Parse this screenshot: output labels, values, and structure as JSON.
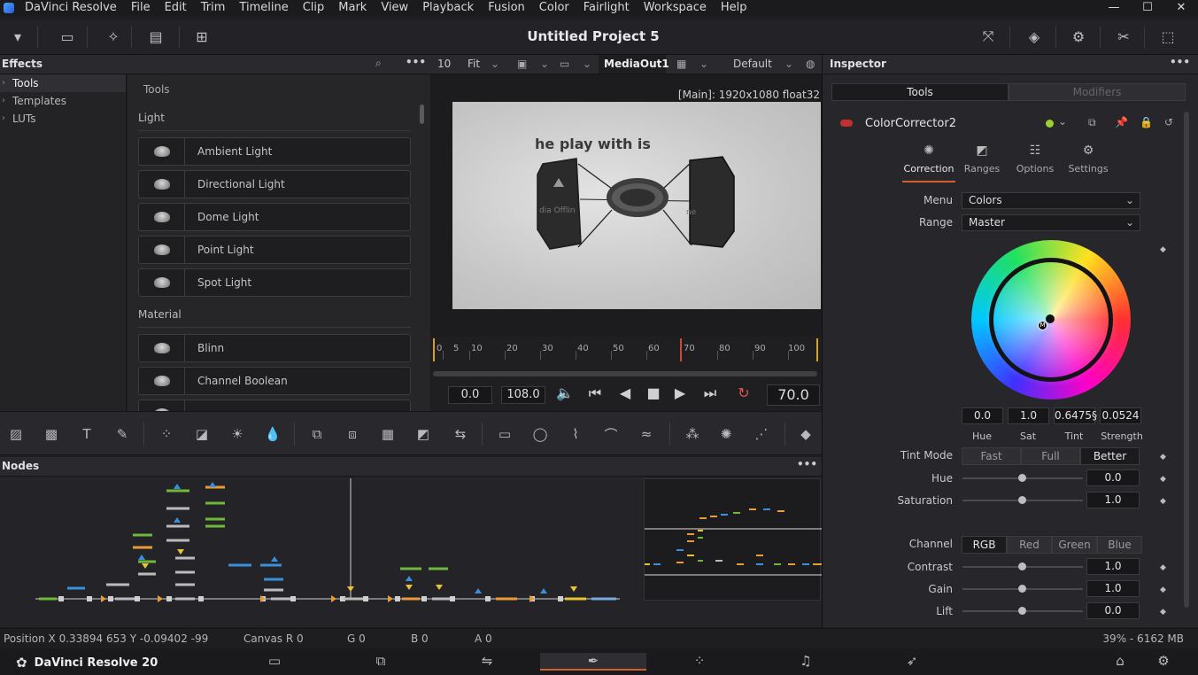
{
  "app": {
    "menu": [
      "DaVinci Resolve",
      "File",
      "Edit",
      "Trim",
      "Timeline",
      "Clip",
      "Mark",
      "View",
      "Playback",
      "Fusion",
      "Color",
      "Fairlight",
      "Workspace",
      "Help"
    ]
  },
  "window_controls": {
    "minimize": "—",
    "maximize": "☐",
    "close": "✕"
  },
  "project_title": "Untitled Project 5",
  "effects": {
    "title": "Effects",
    "tree": [
      "Tools",
      "Templates",
      "LUTs"
    ],
    "list_header": "Tools",
    "sections": [
      {
        "name": "Light",
        "items": [
          "Ambient Light",
          "Directional Light",
          "Dome Light",
          "Point Light",
          "Spot Light"
        ]
      },
      {
        "name": "Material",
        "items": [
          "Blinn",
          "Channel Boolean"
        ]
      }
    ]
  },
  "viewer": {
    "zoom_left": "10",
    "fit": "Fit",
    "output": "MediaOut1",
    "lut": "Default",
    "resolution": "[Main]: 1920x1080 float32",
    "frame_caption": "he play with is",
    "offline_left": "dia Offlin",
    "offline_right": "ne",
    "ruler": [
      "0",
      "5",
      "10",
      "20",
      "30",
      "40",
      "50",
      "60",
      "70",
      "80",
      "90",
      "100"
    ],
    "start": "0.0",
    "end": "108.0",
    "current": "70.0"
  },
  "nodes": {
    "title": "Nodes"
  },
  "status": {
    "position": "Position  X 0.33894   653    Y -0.09402   -99",
    "canvas": "Canvas  R 0",
    "g": "G 0",
    "b": "B 0",
    "a": "A 0",
    "memory": "39% - 6162 MB"
  },
  "pagebar": {
    "brand": "DaVinci Resolve 20",
    "active_page": "fusion"
  },
  "inspector": {
    "title": "Inspector",
    "tabs": [
      "Tools",
      "Modifiers"
    ],
    "node_name": "ColorCorrector2",
    "subtabs": [
      "Correction",
      "Ranges",
      "Options",
      "Settings"
    ],
    "menu_label": "Menu",
    "menu_value": "Colors",
    "range_label": "Range",
    "range_value": "Master",
    "wheel": {
      "hue": "0.0",
      "sat": "1.0",
      "tint": "0.6475§",
      "strength": "0.0524",
      "hue_label": "Hue",
      "sat_label": "Sat",
      "tint_label": "Tint",
      "strength_label": "Strength"
    },
    "tint_mode_label": "Tint Mode",
    "tint_modes": [
      "Fast",
      "Full",
      "Better"
    ],
    "tint_mode_selected": "Better",
    "hue_label": "Hue",
    "hue_value": "0.0",
    "saturation_label": "Saturation",
    "saturation_value": "1.0",
    "channel_label": "Channel",
    "channels": [
      "RGB",
      "Red",
      "Green",
      "Blue"
    ],
    "contrast_label": "Contrast",
    "contrast_value": "1.0",
    "gain_label": "Gain",
    "gain_value": "1.0",
    "lift_label": "Lift",
    "lift_value": "0.0"
  },
  "colors": {
    "accent": "#d06030",
    "node_green": "#6fb93a",
    "node_blue": "#3b8fd8",
    "node_orange": "#e89b3a"
  }
}
